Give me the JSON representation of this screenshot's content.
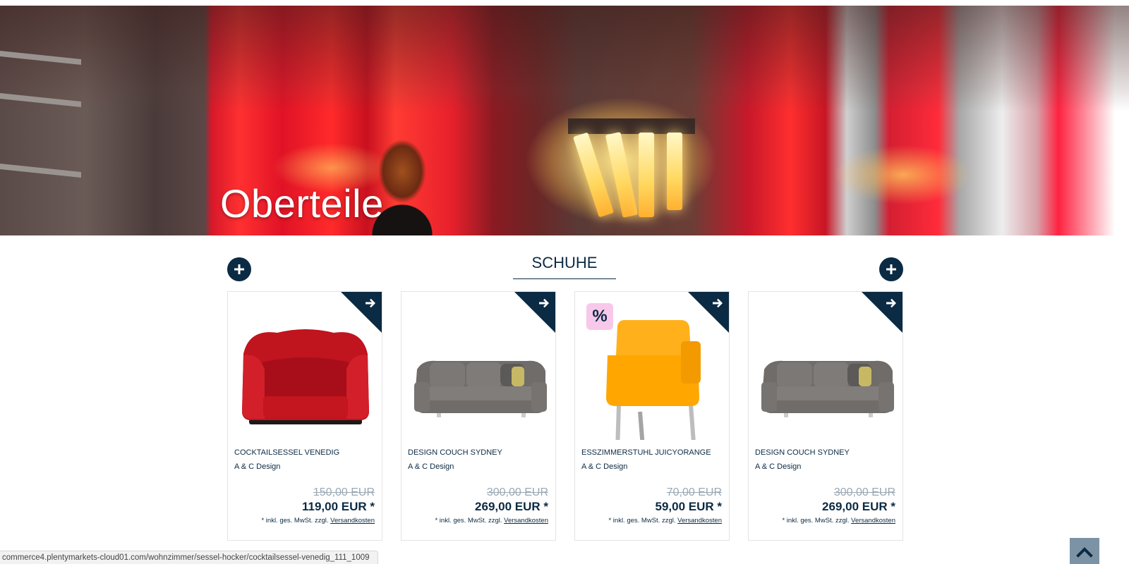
{
  "hero": {
    "title": "Oberteile"
  },
  "section": {
    "title": "SCHUHE"
  },
  "colors": {
    "primary": "#0b2a43",
    "sale_badge": "#f7c8ea",
    "old_price": "#9aa8b4"
  },
  "products": [
    {
      "name": "COCKTAILSESSEL VENEDIG",
      "maker": "A & C Design",
      "old_price": "150,00 EUR",
      "price": "119,00 EUR *",
      "tax": "* inkl. ges. MwSt. zzgl. ",
      "shipping": "Versandkosten",
      "sale": false,
      "image": "red-armchair"
    },
    {
      "name": "DESIGN COUCH SYDNEY",
      "maker": "A & C Design",
      "old_price": "300,00 EUR",
      "price": "269,00 EUR *",
      "tax": "* inkl. ges. MwSt. zzgl. ",
      "shipping": "Versandkosten",
      "sale": false,
      "image": "grey-sofa"
    },
    {
      "name": "ESSZIMMERSTUHL JUICYORANGE",
      "maker": "A & C Design",
      "old_price": "70,00 EUR",
      "price": "59,00 EUR *",
      "tax": "* inkl. ges. MwSt. zzgl. ",
      "shipping": "Versandkosten",
      "sale": true,
      "sale_label": "%",
      "image": "orange-chair"
    },
    {
      "name": "DESIGN COUCH SYDNEY",
      "maker": "A & C Design",
      "old_price": "300,00 EUR",
      "price": "269,00 EUR *",
      "tax": "* inkl. ges. MwSt. zzgl. ",
      "shipping": "Versandkosten",
      "sale": false,
      "image": "grey-sofa"
    }
  ],
  "status_bar": {
    "url": "commerce4.plentymarkets-cloud01.com/wohnzimmer/sessel-hocker/cocktailsessel-venedig_111_1009"
  },
  "icons": {
    "prev": "plus-icon",
    "next": "plus-icon",
    "corner": "arrow-right-icon",
    "scroll_top": "chevron-up-icon"
  }
}
